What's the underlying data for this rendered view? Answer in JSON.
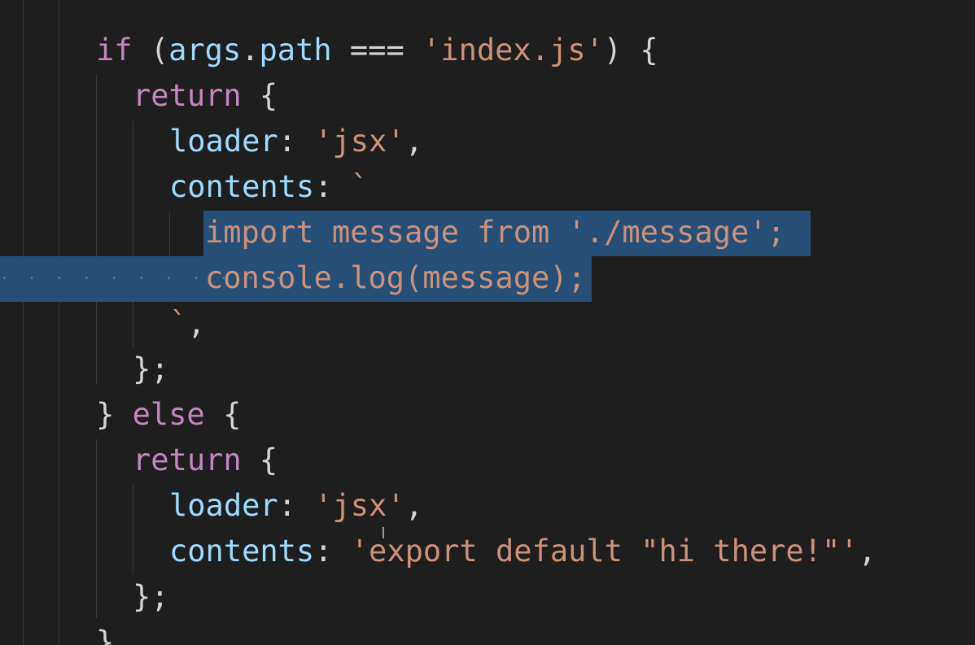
{
  "code_lines": [
    {
      "indent": "if (",
      "parts": [
        {
          "cls": "kw",
          "text": "if"
        },
        {
          "cls": "punc",
          "text": " ("
        },
        {
          "cls": "var",
          "text": "args"
        },
        {
          "cls": "punc",
          "text": "."
        },
        {
          "cls": "var",
          "text": "path"
        },
        {
          "cls": "punc",
          "text": " === "
        },
        {
          "cls": "str",
          "text": "'index.js'"
        },
        {
          "cls": "punc",
          "text": ") {"
        }
      ]
    },
    {
      "parts": [
        {
          "cls": "kw",
          "text": "return"
        },
        {
          "cls": "punc",
          "text": " {"
        }
      ]
    },
    {
      "parts": [
        {
          "cls": "var",
          "text": "loader"
        },
        {
          "cls": "punc",
          "text": ": "
        },
        {
          "cls": "str",
          "text": "'jsx'"
        },
        {
          "cls": "punc",
          "text": ","
        }
      ]
    },
    {
      "parts": [
        {
          "cls": "var",
          "text": "contents"
        },
        {
          "cls": "punc",
          "text": ": "
        },
        {
          "cls": "str",
          "text": "`"
        }
      ]
    },
    {
      "parts": [
        {
          "cls": "str",
          "text": "import message from './message';"
        }
      ]
    },
    {
      "parts": [
        {
          "cls": "str",
          "text": "console.log(message);"
        }
      ]
    },
    {
      "parts": [
        {
          "cls": "str",
          "text": "`"
        },
        {
          "cls": "punc",
          "text": ","
        }
      ]
    },
    {
      "parts": [
        {
          "cls": "punc",
          "text": "};"
        }
      ]
    },
    {
      "parts": [
        {
          "cls": "punc",
          "text": "} "
        },
        {
          "cls": "kw",
          "text": "else"
        },
        {
          "cls": "punc",
          "text": " {"
        }
      ]
    },
    {
      "parts": [
        {
          "cls": "kw",
          "text": "return"
        },
        {
          "cls": "punc",
          "text": " {"
        }
      ]
    },
    {
      "parts": [
        {
          "cls": "var",
          "text": "loader"
        },
        {
          "cls": "punc",
          "text": ": "
        },
        {
          "cls": "str",
          "text": "'jsx'"
        },
        {
          "cls": "punc",
          "text": ","
        }
      ]
    },
    {
      "parts": [
        {
          "cls": "var",
          "text": "contents"
        },
        {
          "cls": "punc",
          "text": ": "
        },
        {
          "cls": "str",
          "text": "'export default \"hi there!\"'"
        },
        {
          "cls": "punc",
          "text": ","
        }
      ]
    },
    {
      "parts": [
        {
          "cls": "punc",
          "text": "};"
        }
      ]
    },
    {
      "parts": [
        {
          "cls": "punc",
          "text": "}"
        }
      ]
    }
  ],
  "colors": {
    "background": "#1e1e1e",
    "selection": "#264f78",
    "keyword": "#c586c0",
    "variable": "#9cdcfe",
    "string": "#ce9178"
  }
}
